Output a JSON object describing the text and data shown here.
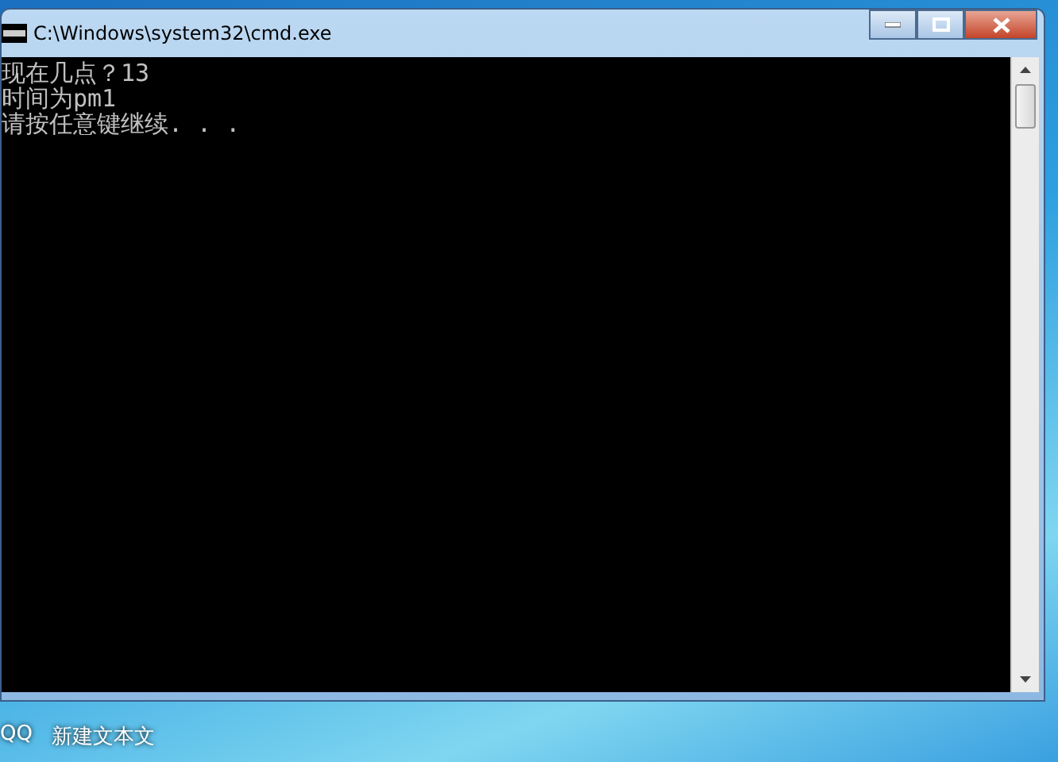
{
  "window": {
    "title": "C:\\Windows\\system32\\cmd.exe"
  },
  "console": {
    "lines": [
      "现在几点？13",
      "时间为pm1",
      "请按任意键继续. . ."
    ]
  },
  "desktop_icons": [
    {
      "label": "QQ"
    },
    {
      "label": "新建文本文"
    }
  ]
}
